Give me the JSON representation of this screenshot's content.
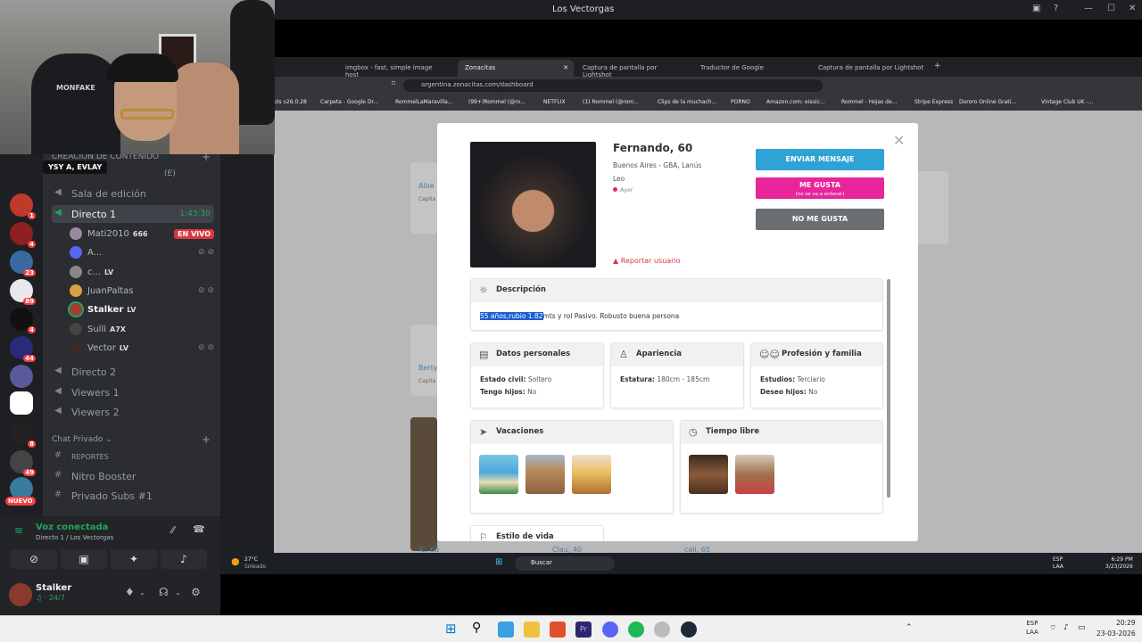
{
  "remote_window": {
    "title": "Los Vectorgas"
  },
  "browser": {
    "tabs": [
      {
        "label": "imgbox - fast, simple image host"
      },
      {
        "label": "Zonacitas"
      },
      {
        "label": "Captura de pantalla por Lightshot"
      },
      {
        "label": "Traductor de Google"
      },
      {
        "label": "Captura de pantalla por Lightshot"
      }
    ],
    "url": "argentina.zonacitas.com/dashboard",
    "bookmarks": [
      "ols v26.0.28",
      "Carpeta - Google Dr...",
      "RommelLaMaravilla...",
      "(99+)Rommel (@ro...",
      "NETFLIX",
      "(1) Rommel (@rom...",
      "Clips de la muchach...",
      "PORNO",
      "Amazon.com: eisoic...",
      "Rommel - Hojas de...",
      "Stripe Express",
      "Dororo Online Grati...",
      "Vintage Club UK -..."
    ]
  },
  "background_cards": {
    "names": [
      "Albe",
      "Berty",
      "IC, 66",
      "Clau, 40",
      "cali, 65"
    ],
    "city": "Capita"
  },
  "profile_modal": {
    "name": "Fernando, 60",
    "location": "Buenos Aires - GBA, Lanús",
    "sign": "Leo",
    "last_seen": "Ayer",
    "report_label": "Reportar usuario",
    "buttons": {
      "message": "ENVIAR MENSAJE",
      "like": "ME GUSTA",
      "like_note": "(no se va a enterar)",
      "dislike": "NO ME GUSTA"
    },
    "description": {
      "title": "Descripción",
      "selected_text": "55 años,rubio 1.82",
      "rest_text": "mts y rol Pasivo. Robusto buena persona"
    },
    "personal": {
      "title": "Datos personales",
      "civil_label": "Estado civil:",
      "civil_value": "Soltero",
      "kids_label": "Tengo hijos:",
      "kids_value": "No"
    },
    "appearance": {
      "title": "Apariencia",
      "height_label": "Estatura:",
      "height_value": "180cm - 185cm"
    },
    "profession": {
      "title": "Profesión y familia",
      "studies_label": "Estudios:",
      "studies_value": "Terciario",
      "kids_wish_label": "Deseo hijos:",
      "kids_wish_value": "No"
    },
    "vacations_title": "Vacaciones",
    "free_time_title": "Tiempo libre",
    "lifestyle_title": "Estilo de vida"
  },
  "discord": {
    "tooltip": "YSY A, EVLAY",
    "category_top": "CREACIÓN DE CONTENIDO",
    "category_top_suffix": "(E)",
    "channels": [
      {
        "name": "Sala de edición"
      },
      {
        "name": "Directo 1",
        "time": "1:43:30"
      },
      {
        "name": "Directo 2"
      },
      {
        "name": "Viewers 1"
      },
      {
        "name": "Viewers 2"
      }
    ],
    "voice_users": [
      {
        "name": "Mati2010",
        "tag": "666",
        "live": "EN VIVO"
      },
      {
        "name": "A..."
      },
      {
        "name": "c...",
        "tag": "LV"
      },
      {
        "name": "JuanPaltas"
      },
      {
        "name": "Stalker",
        "tag": "LV"
      },
      {
        "name": "Sulli",
        "tag": "A7X"
      },
      {
        "name": "Vector",
        "tag": "LV"
      }
    ],
    "chat_category": "Chat Privado",
    "chat_channels": [
      "REPORTES",
      "Nitro Booster",
      "Privado Subs #1"
    ],
    "server_badges": [
      "1",
      "4",
      "23",
      "89",
      "4",
      "44",
      "8",
      "49"
    ],
    "new_badge": "NUEVO",
    "voice_status": "Voz conectada",
    "voice_location": "Directo 1 / Los Vectorgas",
    "user_name": "Stalker",
    "user_status": "24/7"
  },
  "remote_taskbar": {
    "weather_temp": "27°C",
    "weather_text": "Soleado",
    "search": "Buscar",
    "lang1": "ESP",
    "lang2": "LAA",
    "time": "6:29 PM",
    "date": "3/23/2026"
  },
  "host_taskbar": {
    "lang1": "ESP",
    "lang2": "LAA",
    "time": "20:29",
    "date": "23-03-2026"
  }
}
